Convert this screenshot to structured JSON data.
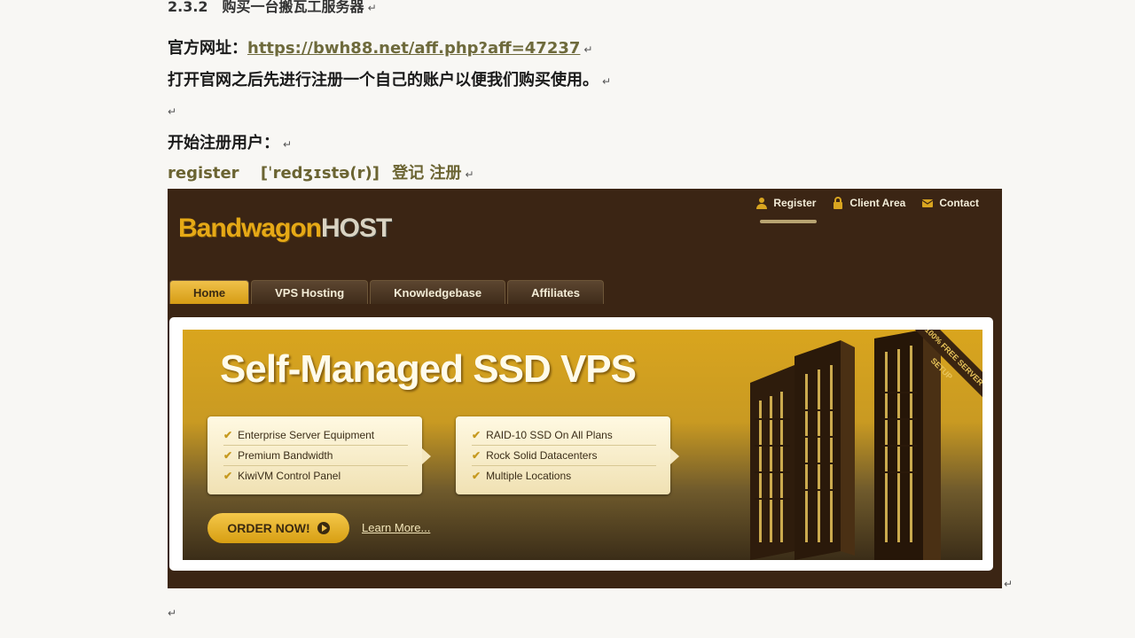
{
  "doc": {
    "heading": "2.3.2　购买一台搬瓦工服务器",
    "official_label": "官方网址：",
    "official_url": "https://bwh88.net/aff.php?aff=47237",
    "instruction": "打开官网之后先进行注册一个自己的账户以便我们购买使用。",
    "start_register": "开始注册用户：",
    "vocab_word": "register",
    "vocab_phonetic": "[ˈredʒɪstə(r)]",
    "vocab_meaning": "登记  注册",
    "para_mark": "↵"
  },
  "site": {
    "top_links": [
      {
        "label": "Register",
        "icon": "user-icon"
      },
      {
        "label": "Client Area",
        "icon": "lock-icon"
      },
      {
        "label": "Contact",
        "icon": "envelope-icon"
      }
    ],
    "logo_part1": "Bandwagon",
    "logo_part2": "HOST",
    "nav": [
      {
        "label": "Home",
        "active": true
      },
      {
        "label": "VPS Hosting",
        "active": false
      },
      {
        "label": "Knowledgebase",
        "active": false
      },
      {
        "label": "Affiliates",
        "active": false
      }
    ],
    "banner": {
      "title": "Self-Managed SSD VPS",
      "features_left": [
        "Enterprise Server Equipment",
        "Premium Bandwidth",
        "KiwiVM Control Panel"
      ],
      "features_right": [
        "RAID-10 SSD On All Plans",
        "Rock Solid Datacenters",
        "Multiple Locations"
      ],
      "order_label": "ORDER NOW!",
      "learn_more": "Learn More...",
      "ribbon": "100% FREE SERVER SETUP"
    }
  }
}
